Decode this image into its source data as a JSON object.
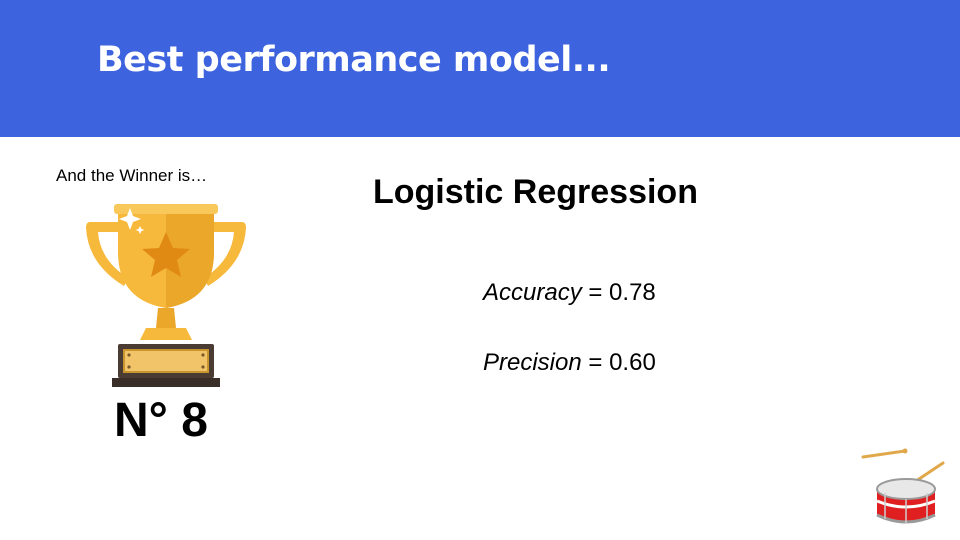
{
  "header": {
    "title": "Best performance model...",
    "background_color": "#3d63de"
  },
  "intro_text": "And the Winner is…",
  "trophy": {
    "icon": "trophy-icon",
    "colors": {
      "gold": "#f6b93b",
      "gold_dark": "#e59e1e",
      "base": "#4a3b33"
    }
  },
  "rank": "N° 8",
  "model": {
    "name": "Logistic Regression",
    "metrics": [
      {
        "name": "Accuracy",
        "value": "= 0.78"
      },
      {
        "name": "Precision",
        "value": "= 0.60"
      }
    ]
  },
  "drum": {
    "icon": "drum-icon",
    "color": "#e02020"
  }
}
